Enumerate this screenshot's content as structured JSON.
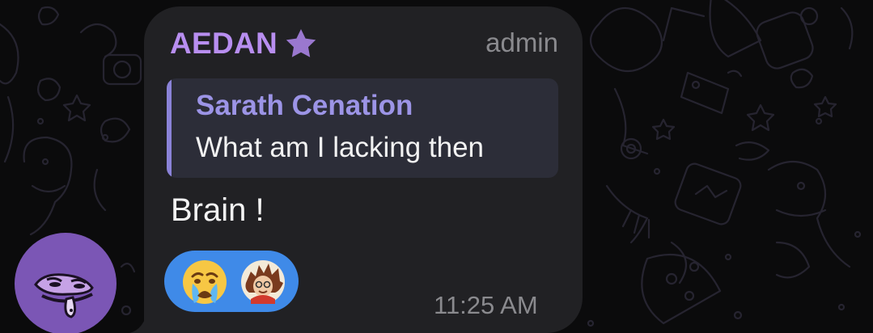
{
  "message": {
    "sender_name": "AEDAN",
    "sender_badge_icon": "star-icon",
    "role_label": "admin",
    "reply": {
      "author": "Sarath Cenation",
      "text": "What am I lacking then"
    },
    "text": "Brain !",
    "reactions": [
      {
        "icon": "crying-face-emoji"
      },
      {
        "icon": "reactor-avatar"
      }
    ],
    "time": "11:25 AM"
  },
  "colors": {
    "sender_name": "#b88ef0",
    "reply_author": "#9c94e6",
    "reply_bar": "#8b83d8",
    "bubble": "#212124",
    "reactions_pill": "#3f8ae8",
    "avatar_bg": "#7b56b5"
  }
}
